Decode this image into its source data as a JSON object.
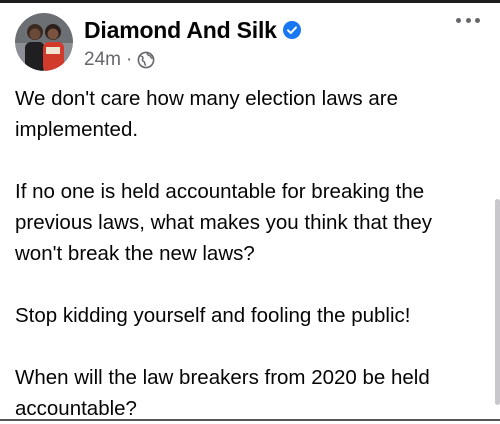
{
  "post": {
    "author": "Diamond And Silk",
    "timestamp": "24m",
    "separator": "·",
    "privacy_icon": "globe-icon",
    "verified_icon": "verified-badge-icon",
    "more_icon": "more-options-icon",
    "paragraphs": [
      "We don't care how many election laws are implemented.",
      "If no one is held accountable for breaking the previous laws, what makes you think that they won't break the new laws?",
      "Stop kidding yourself and fooling the public!",
      "When will the law breakers from 2020 be held accountable?"
    ]
  },
  "colors": {
    "verified_blue": "#1877f2",
    "secondary_text": "#65676b",
    "primary_text": "#050505"
  }
}
